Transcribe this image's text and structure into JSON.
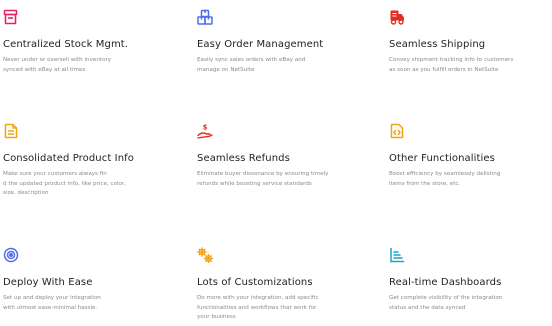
{
  "colors": {
    "pink": "#e8245f",
    "blue": "#4f6ee8",
    "red": "#e52c20",
    "amber": "#f1a417",
    "teal": "#1aa3c8",
    "title": "#222222",
    "description": "#8a8a8a"
  },
  "features": [
    {
      "icon": "inventory-icon",
      "title": "Centralized Stock Mgmt.",
      "description": "Never under or oversell with inventory\nsynced with eBay at all times"
    },
    {
      "icon": "order-boxes-icon",
      "title": "Easy Order Management",
      "description": "Easily sync sales orders with eBay and\nmanage on NetSuite"
    },
    {
      "icon": "shipping-truck-icon",
      "title": "Seamless Shipping",
      "description": "Convey shipment tracking info to customers\nas soon as you fulfill orders in NetSuite"
    },
    {
      "icon": "product-document-icon",
      "title": "Consolidated Product Info",
      "description": "Make sure your customers always fin\nd the updated product info, like price, color,\nsize, description"
    },
    {
      "icon": "refund-hand-icon",
      "title": "Seamless Refunds",
      "description": "Eliminate buyer dissonance by ensuring timely\nrefunds while boosting service standards"
    },
    {
      "icon": "code-file-icon",
      "title": "Other Functionalities",
      "description": "Boost efficiency by seamlessly delisting\nitems from the store, etc."
    },
    {
      "icon": "target-icon",
      "title": "Deploy With Ease",
      "description": "Set up and deploy your integration\nwith utmost ease-minimal hassle."
    },
    {
      "icon": "gears-icon",
      "title": "Lots of Customizations",
      "description": "Do more with your integration, add specific\nfunctionalities and workflows that work for\nyour business"
    },
    {
      "icon": "dashboard-chart-icon",
      "title": "Real-time Dashboards",
      "description": "Get complete visibility of the integration\nstatus and the data synced"
    }
  ]
}
